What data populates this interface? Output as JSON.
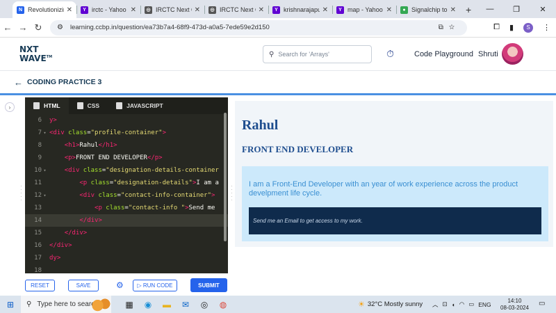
{
  "browser": {
    "tabs": [
      {
        "title": "Revolutionizing",
        "favicon_color": "#2563eb",
        "favicon_glyph": "N"
      },
      {
        "title": "irctc - Yahoo",
        "favicon_color": "#6001d2",
        "favicon_glyph": "Y"
      },
      {
        "title": "IRCTC Next Ge",
        "favicon_color": "#555555",
        "favicon_glyph": "◎"
      },
      {
        "title": "IRCTC Next Ge",
        "favicon_color": "#555555",
        "favicon_glyph": "◎"
      },
      {
        "title": "krishnarajapu",
        "favicon_color": "#6001d2",
        "favicon_glyph": "Y"
      },
      {
        "title": "map - Yahoo",
        "favicon_color": "#6001d2",
        "favicon_glyph": "Y"
      },
      {
        "title": "Signalchip to",
        "favicon_color": "#34a853",
        "favicon_glyph": "●"
      }
    ],
    "url": "learning.ccbp.in/question/ea73b7a4-68f9-473d-a0a5-7ede59e2d150",
    "profile_initial": "S"
  },
  "header": {
    "logo_line1": "NXT",
    "logo_line2": "WAVE",
    "logo_sup": "TM",
    "search_placeholder": "Search for 'Arrays'",
    "code_playground": "Code Playground",
    "user_name": "Shruti"
  },
  "page": {
    "title": "CODING PRACTICE 3"
  },
  "editor": {
    "tabs": [
      {
        "label": "HTML",
        "active": true
      },
      {
        "label": "CSS",
        "active": false
      },
      {
        "label": "JAVASCRIPT",
        "active": false
      }
    ],
    "lines": [
      {
        "n": "6",
        "fold": "",
        "indent": "",
        "parts": [
          [
            "tg",
            "y>"
          ]
        ]
      },
      {
        "n": "7",
        "fold": "▾",
        "indent": "",
        "parts": [
          [
            "tg",
            "<div "
          ],
          [
            "at",
            "class"
          ],
          [
            "tx",
            "="
          ],
          [
            "st",
            "\"profile-container\""
          ],
          [
            "tg",
            ">"
          ]
        ]
      },
      {
        "n": "8",
        "fold": "",
        "indent": "    ",
        "parts": [
          [
            "tg",
            "<h1>"
          ],
          [
            "tx",
            "Rahul"
          ],
          [
            "tg",
            "</h1>"
          ]
        ]
      },
      {
        "n": "9",
        "fold": "",
        "indent": "    ",
        "parts": [
          [
            "tg",
            "<p>"
          ],
          [
            "tx",
            "FRONT END DEVELOPER"
          ],
          [
            "tg",
            "</p>"
          ]
        ]
      },
      {
        "n": "10",
        "fold": "▾",
        "indent": "    ",
        "parts": [
          [
            "tg",
            "<div "
          ],
          [
            "at",
            "class"
          ],
          [
            "tx",
            "="
          ],
          [
            "st",
            "\"designation-details-container"
          ]
        ]
      },
      {
        "n": "11",
        "fold": "",
        "indent": "        ",
        "parts": [
          [
            "tg",
            "<p "
          ],
          [
            "at",
            "class"
          ],
          [
            "tx",
            "="
          ],
          [
            "st",
            "\"designation-details\""
          ],
          [
            "tg",
            ">"
          ],
          [
            "tx",
            "I am a"
          ]
        ]
      },
      {
        "n": "12",
        "fold": "▾",
        "indent": "        ",
        "parts": [
          [
            "tg",
            "<div "
          ],
          [
            "at",
            "class"
          ],
          [
            "tx",
            "="
          ],
          [
            "st",
            "\"contact-info-container\""
          ],
          [
            "tg",
            ">"
          ]
        ]
      },
      {
        "n": "13",
        "fold": "",
        "indent": "            ",
        "parts": [
          [
            "tg",
            "<p "
          ],
          [
            "at",
            "class"
          ],
          [
            "tx",
            "="
          ],
          [
            "st",
            "\"contact-info \""
          ],
          [
            "tg",
            ">"
          ],
          [
            "tx",
            "Send me"
          ]
        ]
      },
      {
        "n": "14",
        "fold": "",
        "indent": "        ",
        "parts": [
          [
            "tg",
            "</div>"
          ]
        ],
        "current": true
      },
      {
        "n": "15",
        "fold": "",
        "indent": "    ",
        "parts": [
          [
            "tg",
            "</div>"
          ]
        ]
      },
      {
        "n": "16",
        "fold": "",
        "indent": "",
        "parts": [
          [
            "tg",
            "</div>"
          ]
        ]
      },
      {
        "n": "17",
        "fold": "",
        "indent": "",
        "parts": [
          [
            "tg",
            "dy>"
          ]
        ]
      },
      {
        "n": "18",
        "fold": "",
        "indent": "",
        "parts": []
      }
    ],
    "reset_label": "RESET",
    "save_label": "SAVE",
    "run_label": "RUN CODE",
    "submit_label": "SUBMIT"
  },
  "preview": {
    "name": "Rahul",
    "role": "FRONT END DEVELOPER",
    "description": "I am a Front-End Developer with an year of work experience across the product develpment life cycle.",
    "contact": "Send me an Email to get access to my work."
  },
  "taskbar": {
    "search_placeholder": "Type here to search",
    "weather": "32°C  Mostly sunny",
    "lang": "ENG",
    "time": "14:10",
    "date": "08-03-2024"
  },
  "colors": {
    "accent": "#2563eb",
    "heading": "#1f4e8f",
    "editor_bg": "#272822"
  }
}
